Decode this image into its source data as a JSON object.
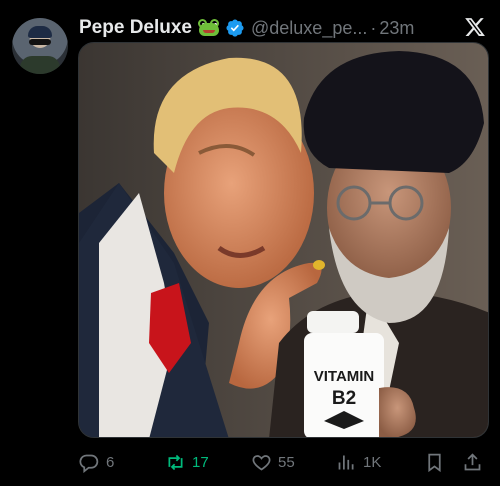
{
  "author": {
    "display_name": "Pepe Deluxe",
    "handle": "@deluxe_pe...",
    "separator": "·",
    "timestamp": "23m",
    "badge_emoji": "frog-face-emoji",
    "verified_icon": "verified-badge-icon"
  },
  "media": {
    "bottle_label_line1": "VITAMIN",
    "bottle_label_line2": "B2"
  },
  "actions": {
    "replies": "6",
    "reposts": "17",
    "likes": "55",
    "views": "1K"
  },
  "colors": {
    "background": "#000000",
    "text_primary": "#e7e9ea",
    "text_secondary": "#71767b",
    "verified_blue": "#1d9bf0",
    "repost_green": "#00ba7c"
  },
  "icons": {
    "reply": "reply-icon",
    "repost": "repost-icon",
    "like": "heart-icon",
    "views": "views-icon",
    "bookmark": "bookmark-icon",
    "share": "share-icon",
    "platform": "x-logo-icon"
  }
}
